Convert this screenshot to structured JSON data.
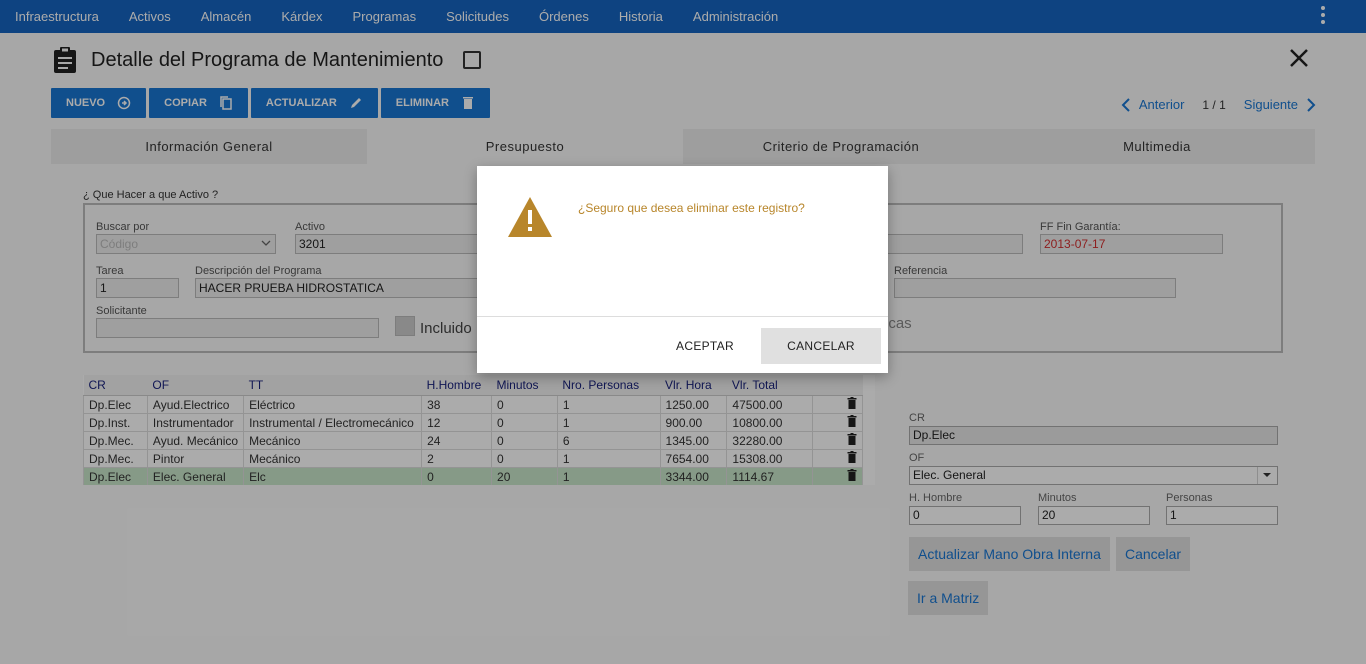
{
  "nav": [
    "Infraestructura",
    "Activos",
    "Almacén",
    "Kárdex",
    "Programas",
    "Solicitudes",
    "Órdenes",
    "Historia",
    "Administración"
  ],
  "page_title": "Detalle del Programa de Mantenimiento",
  "toolbar": {
    "nuevo": "NUEVO",
    "copiar": "COPIAR",
    "actualizar": "ACTUALIZAR",
    "eliminar": "ELIMINAR"
  },
  "pager": {
    "prev": "Anterior",
    "count": "1 / 1",
    "next": "Siguiente"
  },
  "tabs": [
    "Información General",
    "Presupuesto",
    "Criterio de Programación",
    "Multimedia"
  ],
  "form": {
    "section_label": "¿ Que Hacer a que Activo ?",
    "buscar_label": "Buscar por",
    "buscar_value": "Código",
    "activo_label": "Activo",
    "activo_value": "3201",
    "ff_label": "FF Fin Garantía:",
    "ff_value": "2013-07-17",
    "tarea_label": "Tarea",
    "tarea_value": "1",
    "desc_label": "Descripción del Programa",
    "desc_value": "HACER PRUEBA HIDROSTATICA",
    "referencia_label": "Referencia",
    "solicitante_label": "Solicitante",
    "incluido_label": "Incluido",
    "partial_text": "icas"
  },
  "table": {
    "headers": [
      "CR",
      "OF",
      "TT",
      "H.Hombre",
      "Minutos",
      "Nro. Personas",
      "Vlr. Hora",
      "Vlr. Total"
    ],
    "rows": [
      [
        "Dp.Elec",
        "Ayud.Electrico",
        "Eléctrico",
        "38",
        "0",
        "1",
        "1250.00",
        "47500.00"
      ],
      [
        "Dp.Inst.",
        "Instrumentador",
        "Instrumental / Electromecánico",
        "12",
        "0",
        "1",
        "900.00",
        "10800.00"
      ],
      [
        "Dp.Mec.",
        "Ayud. Mecánico",
        "Mecánico",
        "24",
        "0",
        "6",
        "1345.00",
        "32280.00"
      ],
      [
        "Dp.Mec.",
        "Pintor",
        "Mecánico",
        "2",
        "0",
        "1",
        "7654.00",
        "15308.00"
      ],
      [
        "Dp.Elec",
        "Elec. General",
        "Elc",
        "0",
        "20",
        "1",
        "3344.00",
        "1114.67"
      ]
    ]
  },
  "right_panel": {
    "cr_label": "CR",
    "cr_value": "Dp.Elec",
    "of_label": "OF",
    "of_value": "Elec. General",
    "hh_label": "H. Hombre",
    "hh_value": "0",
    "min_label": "Minutos",
    "min_value": "20",
    "per_label": "Personas",
    "per_value": "1",
    "btn_update": "Actualizar Mano Obra Interna",
    "btn_cancel": "Cancelar",
    "btn_matrix": "Ir a Matriz"
  },
  "dialog": {
    "message": "¿Seguro que desea eliminar este registro?",
    "accept": "ACEPTAR",
    "cancel": "CANCELAR"
  },
  "colors": {
    "primary": "#1976d2",
    "nav": "#1565c0",
    "warning": "#b8862b",
    "error": "#d32f2f",
    "selected_row": "#c8e6c9"
  }
}
